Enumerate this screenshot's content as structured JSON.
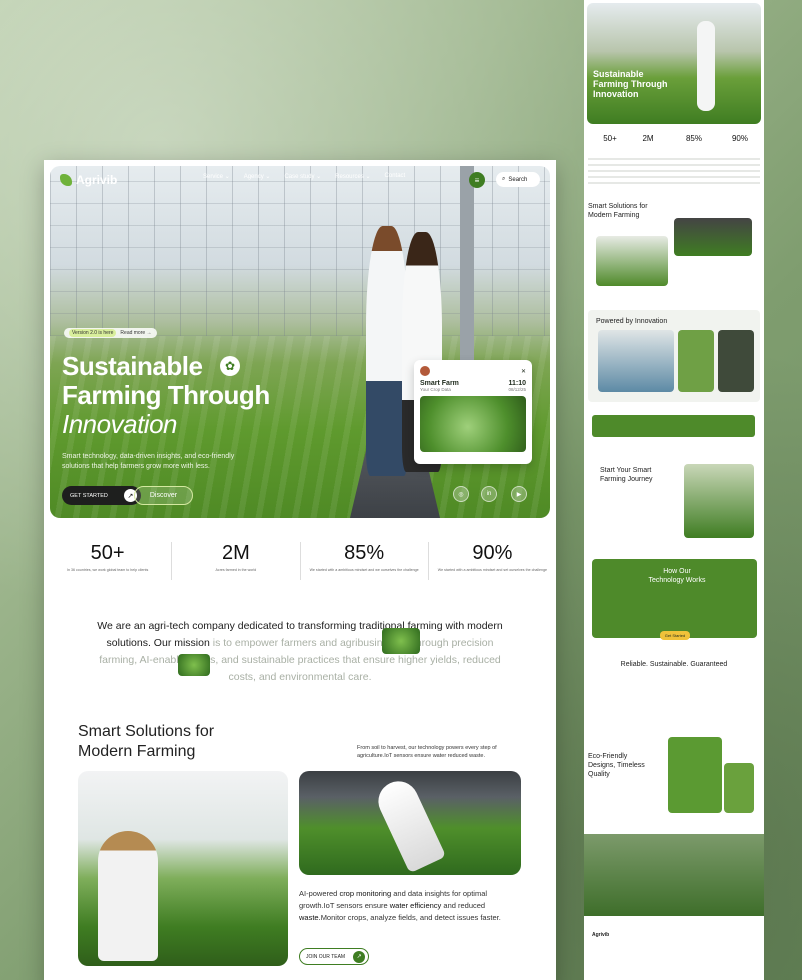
{
  "brand": {
    "name": "Agrivib"
  },
  "nav": {
    "items": [
      "Service",
      "Agency",
      "Case study",
      "Resources",
      "Contact"
    ],
    "search": "Search"
  },
  "hero": {
    "badge_version": "Version 2.0 is here",
    "badge_link": "Read more →",
    "title_line1": "Sustainable",
    "title_line2": "Farming Through",
    "title_line3": "Innovation",
    "subtitle": "Smart technology, data-driven insights, and eco-friendly solutions that help farmers grow more with less.",
    "cta_primary": "GET STARTED",
    "cta_secondary": "Discover",
    "card": {
      "title": "Smart Farm",
      "time": "11:10",
      "label": "Your Crop Data",
      "date": "08/12/25"
    },
    "social": [
      "instagram-icon",
      "linkedin-icon",
      "youtube-icon"
    ]
  },
  "stats": [
    {
      "value": "50+",
      "desc": "In 36 countries, we work global team to help clients"
    },
    {
      "value": "2M",
      "desc": "Acres farmed in the world"
    },
    {
      "value": "85%",
      "desc": "We started with a ambitious mindset and we ourselves the challenge"
    },
    {
      "value": "90%",
      "desc": "We started with a ambitious mindset and set ourselves the challenge"
    }
  ],
  "about": {
    "dark": "We are an agri-tech company dedicated to transforming traditional farming with modern solutions. Our mission",
    "light": " is to empower farmers and agribusinesses through precision farming, AI-enabled tools, and sustainable practices that ensure higher yields, reduced costs, and environmental care."
  },
  "solutions": {
    "title": "Smart Solutions for Modern Farming",
    "note": "From soil to harvest, our technology powers every step of agriculture.IoT sensors ensure water reduced waste.",
    "desc_a": "AI-powered ",
    "desc_b": "crop monitoring",
    "desc_c": " and data insights for optimal growth.IoT sensors ensure ",
    "desc_d": "water efficiency",
    "desc_e": " and reduced ",
    "desc_f": "waste.",
    "desc_g": "Monitor crops, analyze fields, and detect issues faster.",
    "cta": "JOIN OUR TEAM"
  },
  "right": {
    "hero_title": "Sustainable Farming Through Innovation",
    "stats": [
      "50+",
      "2M",
      "85%",
      "90%"
    ],
    "smart": "Smart Solutions for Modern Farming",
    "powered": "Powered by Innovation",
    "journey": "Start Your Smart Farming Journey",
    "how": "How Our Technology Works",
    "get_started": "Get Started",
    "reliable": "Reliable. Sustainable. Guaranteed",
    "eco": "Eco-Friendly Designs, Timeless Quality",
    "footer_brand": "Agrivib"
  },
  "colors": {
    "accent": "#3f7d22",
    "dark": "#1e1f1e",
    "light_green": "#d9ef9c"
  }
}
